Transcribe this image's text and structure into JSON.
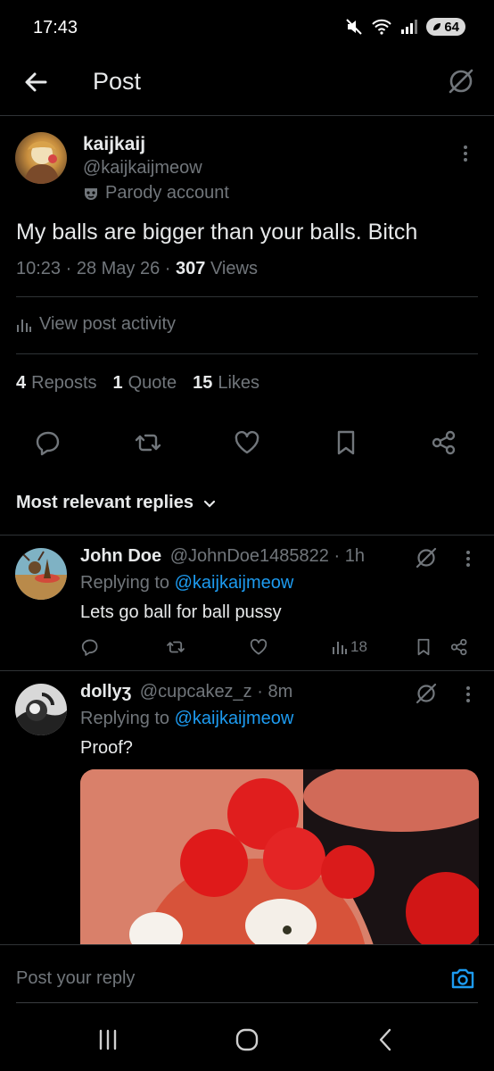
{
  "status": {
    "time": "17:43",
    "battery": "64"
  },
  "header": {
    "title": "Post"
  },
  "post": {
    "author_name": "kaijkaij",
    "author_handle": "@kaijkaijmeow",
    "badge_label": "Parody account",
    "text": "My balls are bigger than your balls. Bitch",
    "time": "10:23",
    "date": "28 May 26",
    "views_count": "307",
    "views_label": "Views",
    "activity_label": "View post activity",
    "reposts_count": "4",
    "reposts_label": "Reposts",
    "quotes_count": "1",
    "quotes_label": "Quote",
    "likes_count": "15",
    "likes_label": "Likes"
  },
  "replies_sort": {
    "label": "Most relevant replies"
  },
  "replies": [
    {
      "name": "John Doe",
      "handle": "@JohnDoe1485822",
      "time": "1h",
      "replying_prefix": "Replying to",
      "replying_to": "@kaijkaijmeow",
      "text": "Lets go ball for ball pussy",
      "views": "18"
    },
    {
      "name": "dollyʒ",
      "handle": "@cupcakez_z",
      "time": "8m",
      "replying_prefix": "Replying to",
      "replying_to": "@kaijkaijmeow",
      "text": "Proof?"
    }
  ],
  "composer": {
    "placeholder": "Post your reply"
  },
  "colors": {
    "background": "#000000",
    "text": "#e7e9ea",
    "muted": "#71767b",
    "accent": "#1d9bf0",
    "divider": "#2f3336"
  },
  "icons": [
    "back-arrow-icon",
    "grok-icon",
    "more-icon",
    "mask-icon",
    "bar-chart-icon",
    "reply-icon",
    "repost-icon",
    "like-icon",
    "bookmark-icon",
    "share-icon",
    "chevron-down-icon",
    "camera-icon",
    "recents-icon",
    "home-icon",
    "back-icon"
  ]
}
